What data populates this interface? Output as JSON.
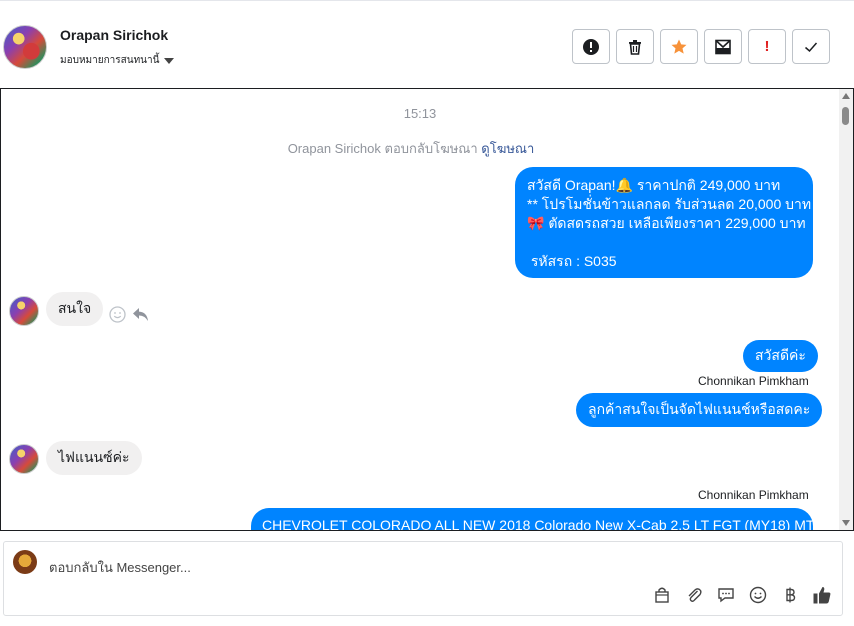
{
  "header": {
    "contact_name": "Orapan Sirichok",
    "assign_label": "มอบหมายการสนทนานี้",
    "toolbar": {
      "spam_icon": "alert-circle-icon",
      "delete_icon": "trash-icon",
      "star_icon": "star-icon",
      "move_icon": "archive-icon",
      "flag_label": "!",
      "done_icon": "check-icon"
    }
  },
  "chat": {
    "timestamp": "15:13",
    "ad_note": "Orapan Sirichok ตอบกลับโฆษณา ",
    "ad_link": "ดูโฆษณา",
    "messages": [
      {
        "from": "page",
        "text": "สวัสดี Orapan!🔔 ราคาปกติ 249,000 บาท\n** โปรโมชั่นข้าวแลกลด รับส่วนลด 20,000 บาท\n🎀 ตัดสดรถสวย เหลือเพียงราคา 229,000 บาท\n\n รหัสรถ : S035"
      },
      {
        "from": "customer",
        "text": "สนใจ"
      },
      {
        "from": "page",
        "text": "สวัสดีค่ะ"
      },
      {
        "sender_label": "Chonnikan Pimkham"
      },
      {
        "from": "page",
        "text": "ลูกค้าสนใจเป็นจัดไฟแนนช์หรือสดคะ"
      },
      {
        "from": "customer",
        "text": "ไฟแนนซ์ค่ะ"
      },
      {
        "sender_label": "Chonnikan Pimkham"
      },
      {
        "from": "page",
        "text": "CHEVROLET COLORADO ALL NEW 2018 Colorado New X-Cab 2.5 LT FGT (MY18) MT"
      }
    ]
  },
  "composer": {
    "placeholder": "ตอบกลับใน Messenger..."
  },
  "colors": {
    "accent": "#0084ff",
    "star": "#f7923a",
    "flag": "#e02020"
  }
}
